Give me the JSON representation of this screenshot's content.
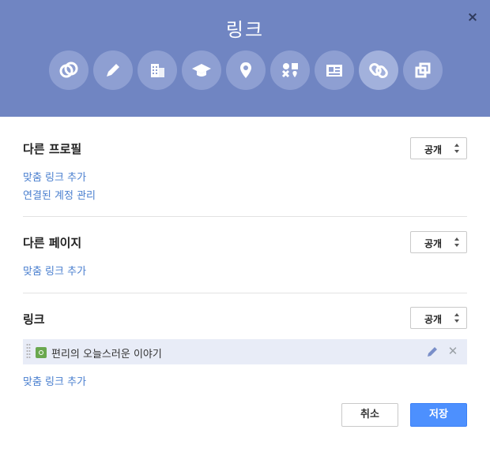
{
  "dialog": {
    "title": "링크",
    "close_label": "×"
  },
  "categories": [
    {
      "icon": "circles-icon"
    },
    {
      "icon": "pencil-icon"
    },
    {
      "icon": "building-icon"
    },
    {
      "icon": "graduation-cap-icon"
    },
    {
      "icon": "location-pin-icon"
    },
    {
      "icon": "people-icon"
    },
    {
      "icon": "contact-card-icon"
    },
    {
      "icon": "link-icon",
      "active": true
    },
    {
      "icon": "squares-icon"
    }
  ],
  "sections": {
    "other_profiles": {
      "title": "다른 프로필",
      "visibility": "공개",
      "links": [
        "맞춤 링크 추가",
        "연결된 계정 관리"
      ]
    },
    "contributor_to": {
      "title": "다른 페이지",
      "visibility": "공개",
      "links": [
        "맞춤 링크 추가"
      ]
    },
    "links": {
      "title": "링크",
      "visibility": "공개",
      "items": [
        {
          "text": "편리의 오늘스러운 이야기"
        }
      ],
      "add_link": "맞춤 링크 추가"
    }
  },
  "buttons": {
    "cancel": "취소",
    "save": "저장"
  },
  "colors": {
    "header": "#7085c2",
    "link": "#4a7fcf",
    "save": "#4d90fe"
  }
}
